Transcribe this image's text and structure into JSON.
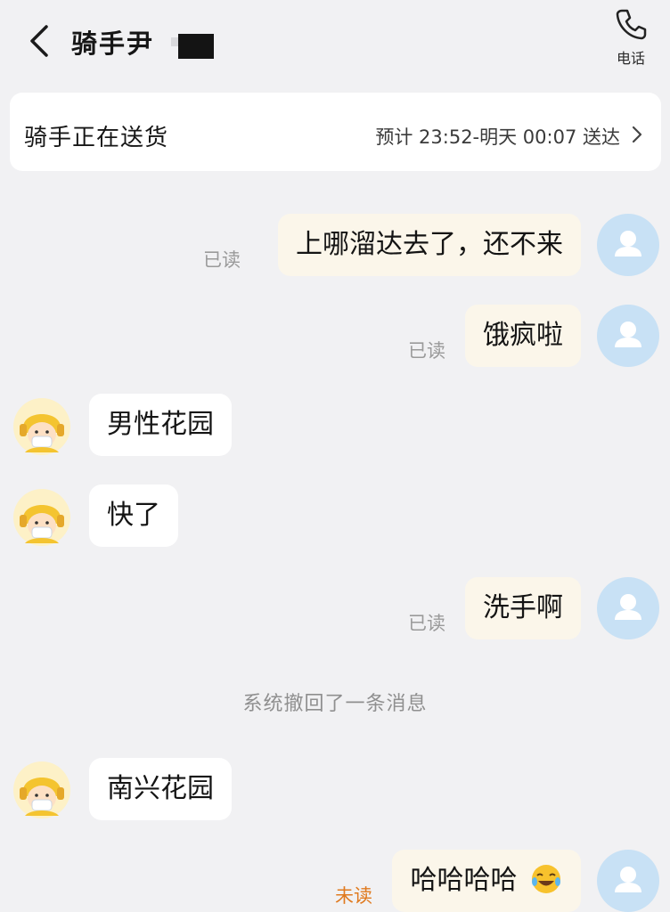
{
  "header": {
    "title": "骑手尹",
    "phone_label": "电话"
  },
  "status": {
    "text": "骑手正在送货",
    "eta": "预计 23:52-明天 00:07 送达"
  },
  "messages": [
    {
      "side": "out",
      "text": "上哪溜达去了，还不来",
      "status": "已读"
    },
    {
      "side": "out",
      "text": "饿疯啦",
      "status": "已读"
    },
    {
      "side": "in",
      "text": "男性花园"
    },
    {
      "side": "in",
      "text": "快了"
    },
    {
      "side": "out",
      "text": "洗手啊",
      "status": "已读"
    },
    {
      "side": "in",
      "text": "南兴花园"
    },
    {
      "side": "out",
      "text": "哈哈哈哈",
      "status": "未读",
      "emoji": "laughing-tears-emoji"
    }
  ],
  "system_note": "系统撤回了一条消息",
  "icons": {
    "back": "chevron-left-icon",
    "phone": "phone-icon",
    "status_arrow": "chevron-right-icon",
    "user_avatar": "person-icon",
    "rider_avatar": "rider-helmet-avatar"
  },
  "colors": {
    "background": "#f1f1f3",
    "outgoing_bubble": "#fbf6ea",
    "incoming_bubble": "#ffffff",
    "user_avatar": "#c8e1f5",
    "read_status": "#9a9a9a",
    "unread_status": "#e07a1f",
    "rider_helmet": "#f4c430"
  }
}
